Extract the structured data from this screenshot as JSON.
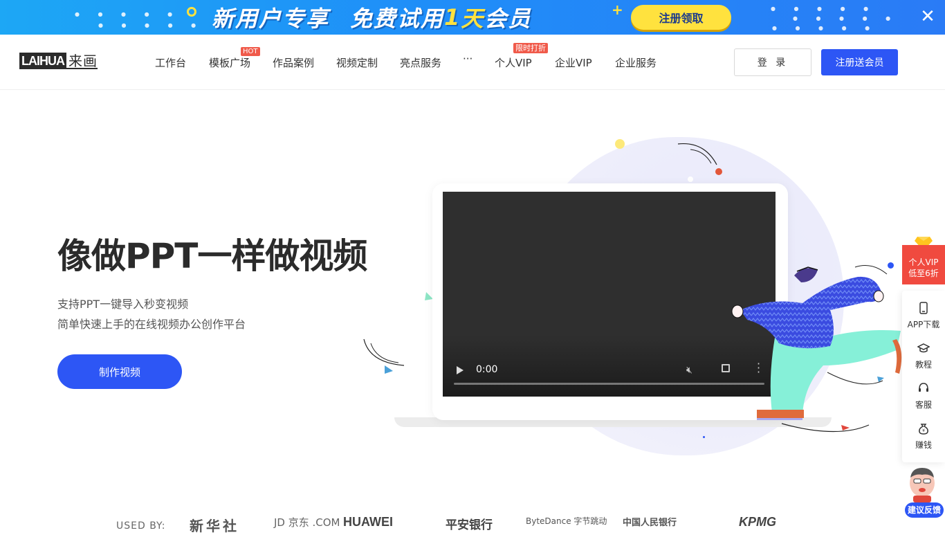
{
  "promo": {
    "headline_left": "新用户专享",
    "headline_right_a": "免费试用",
    "headline_right_num": "1",
    "headline_right_b": "天",
    "headline_right_c": "会员",
    "cta": "注册领取",
    "close_icon": "close-icon"
  },
  "header": {
    "logo_en": "LAIHUA",
    "logo_cn": "来画",
    "nav": [
      {
        "label": "工作台"
      },
      {
        "label": "模板广场",
        "badge": "HOT"
      },
      {
        "label": "作品案例"
      },
      {
        "label": "视频定制"
      },
      {
        "label": "亮点服务"
      },
      {
        "label": "···"
      },
      {
        "label": "个人VIP",
        "badge": "限时打折"
      },
      {
        "label": "企业VIP"
      },
      {
        "label": "企业服务"
      }
    ],
    "login": "登 录",
    "register": "注册送会员"
  },
  "hero": {
    "title": "像做PPT一样做视频",
    "subtitle_1": "支持PPT一键导入秒变视频",
    "subtitle_2": "简单快速上手的在线视频办公创作平台",
    "cta": "制作视频"
  },
  "video": {
    "time": "0:00",
    "progress": 0,
    "muted": true
  },
  "sidebar": {
    "vip_line1": "个人VIP",
    "vip_line2": "低至6折",
    "items": [
      {
        "label": "APP下载",
        "icon": "phone-icon"
      },
      {
        "label": "教程",
        "icon": "graduation-cap-icon"
      },
      {
        "label": "客服",
        "icon": "headset-icon"
      },
      {
        "label": "赚钱",
        "icon": "money-bag-icon"
      }
    ],
    "feedback": "建议反馈"
  },
  "used_by": {
    "label": "USED BY:",
    "brands": [
      "新华社",
      "JD 京东 .COM",
      "HUAWEI",
      "平安银行",
      "ByteDance 字节跳动",
      "中国人民银行",
      "KPMG"
    ]
  },
  "colors": {
    "primary": "#2d56f5",
    "promo_yellow": "#ffe23e",
    "badge_red": "#f05a4a"
  }
}
